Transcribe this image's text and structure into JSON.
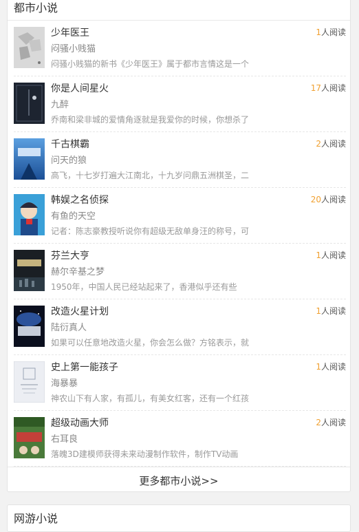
{
  "section": {
    "title": "都市小说",
    "more_label": "更多都市小说>>"
  },
  "books": [
    {
      "title": "少年医王",
      "author": "闷骚小贱猫",
      "desc": "闷骚小贱猫的新书《少年医王》属于都市言情这是一个",
      "reads": "1",
      "reads_suffix": "人阅读"
    },
    {
      "title": "你是人间星火",
      "author": "九醉",
      "desc": "乔南和梁非城的爱情角逐就是我爱你的时候，你想杀了",
      "reads": "17",
      "reads_suffix": "人阅读"
    },
    {
      "title": "千古棋霸",
      "author": "问天的狼",
      "desc": "高飞，十七岁打遍大江南北，十九岁问鼎五洲棋圣，二",
      "reads": "2",
      "reads_suffix": "人阅读"
    },
    {
      "title": "韩娱之名侦探",
      "author": "有鱼的天空",
      "desc": "记者：陈志豪教授听说你有超级无敌单身汪的称号，可",
      "reads": "20",
      "reads_suffix": "人阅读"
    },
    {
      "title": "芬兰大亨",
      "author": "赫尔辛基之梦",
      "desc": "1950年，中国人民已经站起来了，香港似乎还有些",
      "reads": "1",
      "reads_suffix": "人阅读"
    },
    {
      "title": "改造火星计划",
      "author": "陆衍真人",
      "desc": "如果可以任意地改造火星，你会怎么做？方铭表示，就",
      "reads": "1",
      "reads_suffix": "人阅读"
    },
    {
      "title": "史上第一能孩子",
      "author": "海暴暴",
      "desc": "神农山下有人家，有孤儿，有美女红客，还有一个红孩",
      "reads": "1",
      "reads_suffix": "人阅读"
    },
    {
      "title": "超级动画大师",
      "author": "右耳良",
      "desc": "落魄3D建模师获得未来动漫制作软件，制作TV动画",
      "reads": "2",
      "reads_suffix": "人阅读"
    }
  ],
  "next_section": {
    "title": "网游小说"
  }
}
